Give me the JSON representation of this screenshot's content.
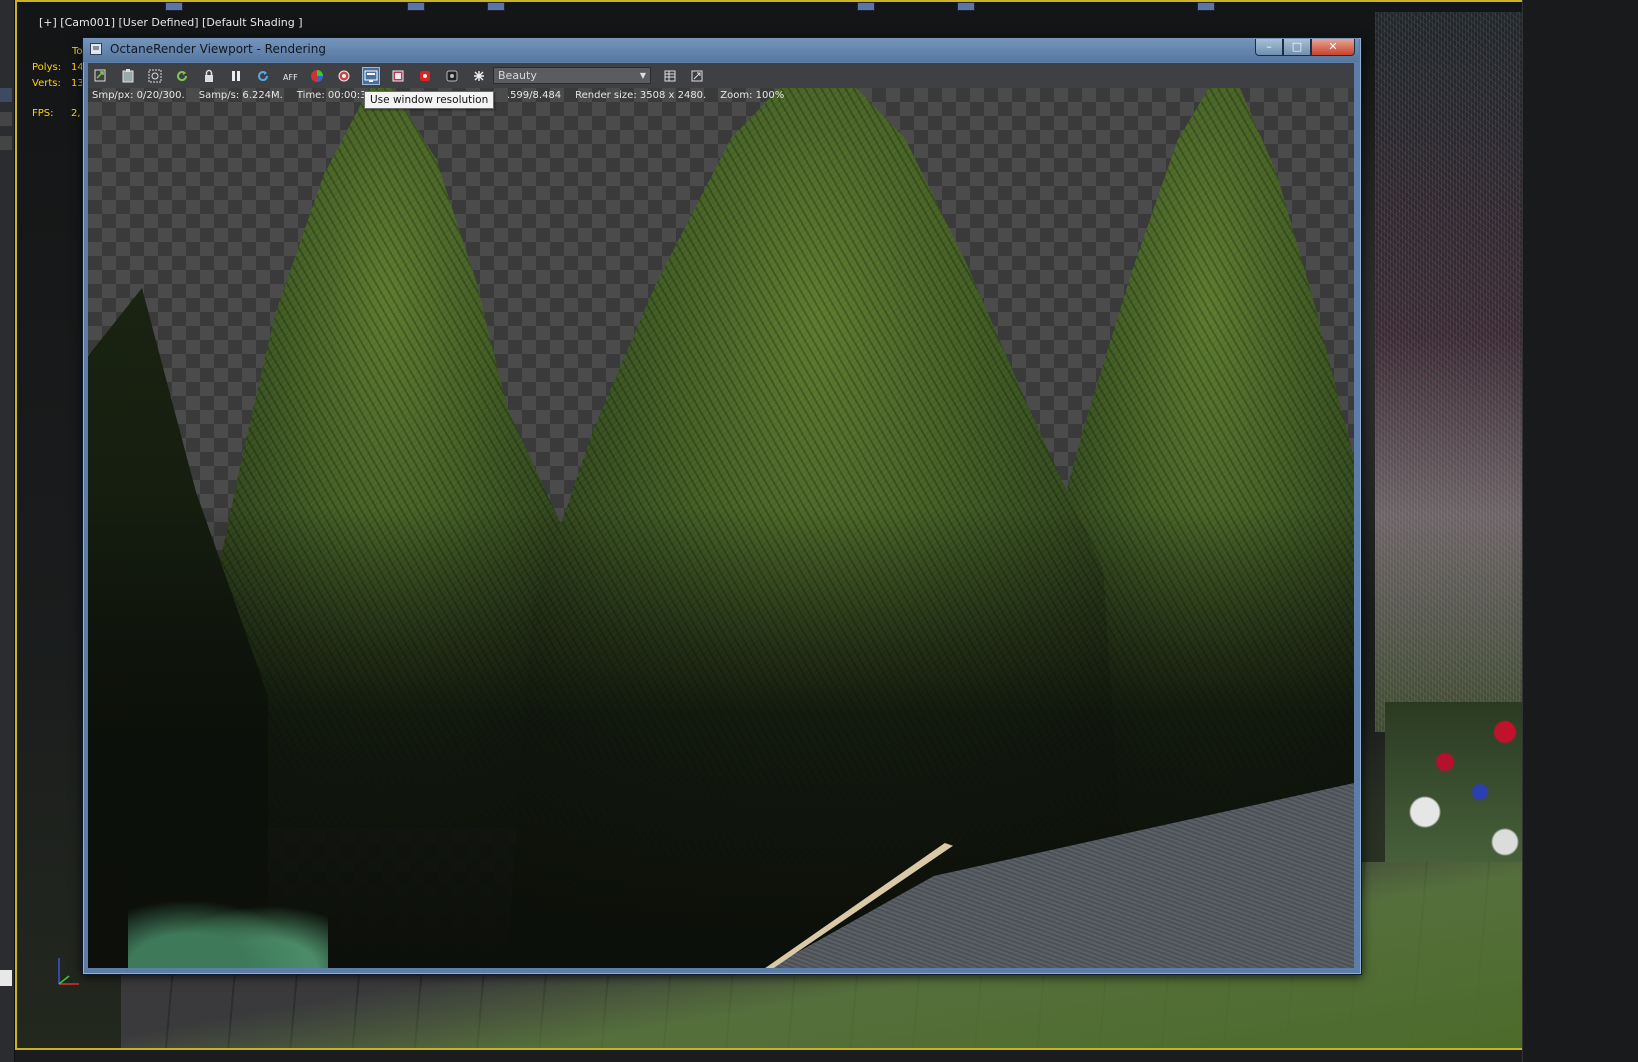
{
  "max": {
    "viewport_label": "[+] [Cam001] [User Defined] [Default Shading ]",
    "stats": {
      "total_label": "Tot",
      "polys_label": "Polys:",
      "polys_value": "14",
      "verts_label": "Verts:",
      "verts_value": "13",
      "fps_label": "FPS:",
      "fps_value": "2,"
    },
    "border_color": "#c9b323",
    "stats_color": "#ffd400"
  },
  "octane": {
    "title": "OctaneRender Viewport - Rendering",
    "toolbar": {
      "buttons": [
        {
          "name": "send-scene"
        },
        {
          "name": "clipboard"
        },
        {
          "name": "zoom-region"
        },
        {
          "name": "restart"
        },
        {
          "name": "lock"
        },
        {
          "name": "pause"
        },
        {
          "name": "refresh"
        },
        {
          "name": "aff"
        },
        {
          "name": "color-picker"
        },
        {
          "name": "settings"
        },
        {
          "name": "use-window-resolution",
          "active": true
        },
        {
          "name": "film-region"
        },
        {
          "name": "material-picker"
        },
        {
          "name": "object-picker"
        },
        {
          "name": "clay-mode"
        }
      ],
      "pass_select": "Beauty"
    },
    "stats": {
      "smp_px": "Smp/px: 0/20/300.",
      "samp_s": "Samp/s: 6.224M.",
      "time": "Time: 00:00:30 / 0",
      "mem": ".599/8.484",
      "render_size": "Render size: 3508 x 2480.",
      "zoom": "Zoom: 100%"
    },
    "tooltip": "Use window resolution",
    "window_buttons": {
      "minimize": "–",
      "maximize": "□",
      "close": "✕"
    },
    "accent_color": "#5b7da7"
  }
}
